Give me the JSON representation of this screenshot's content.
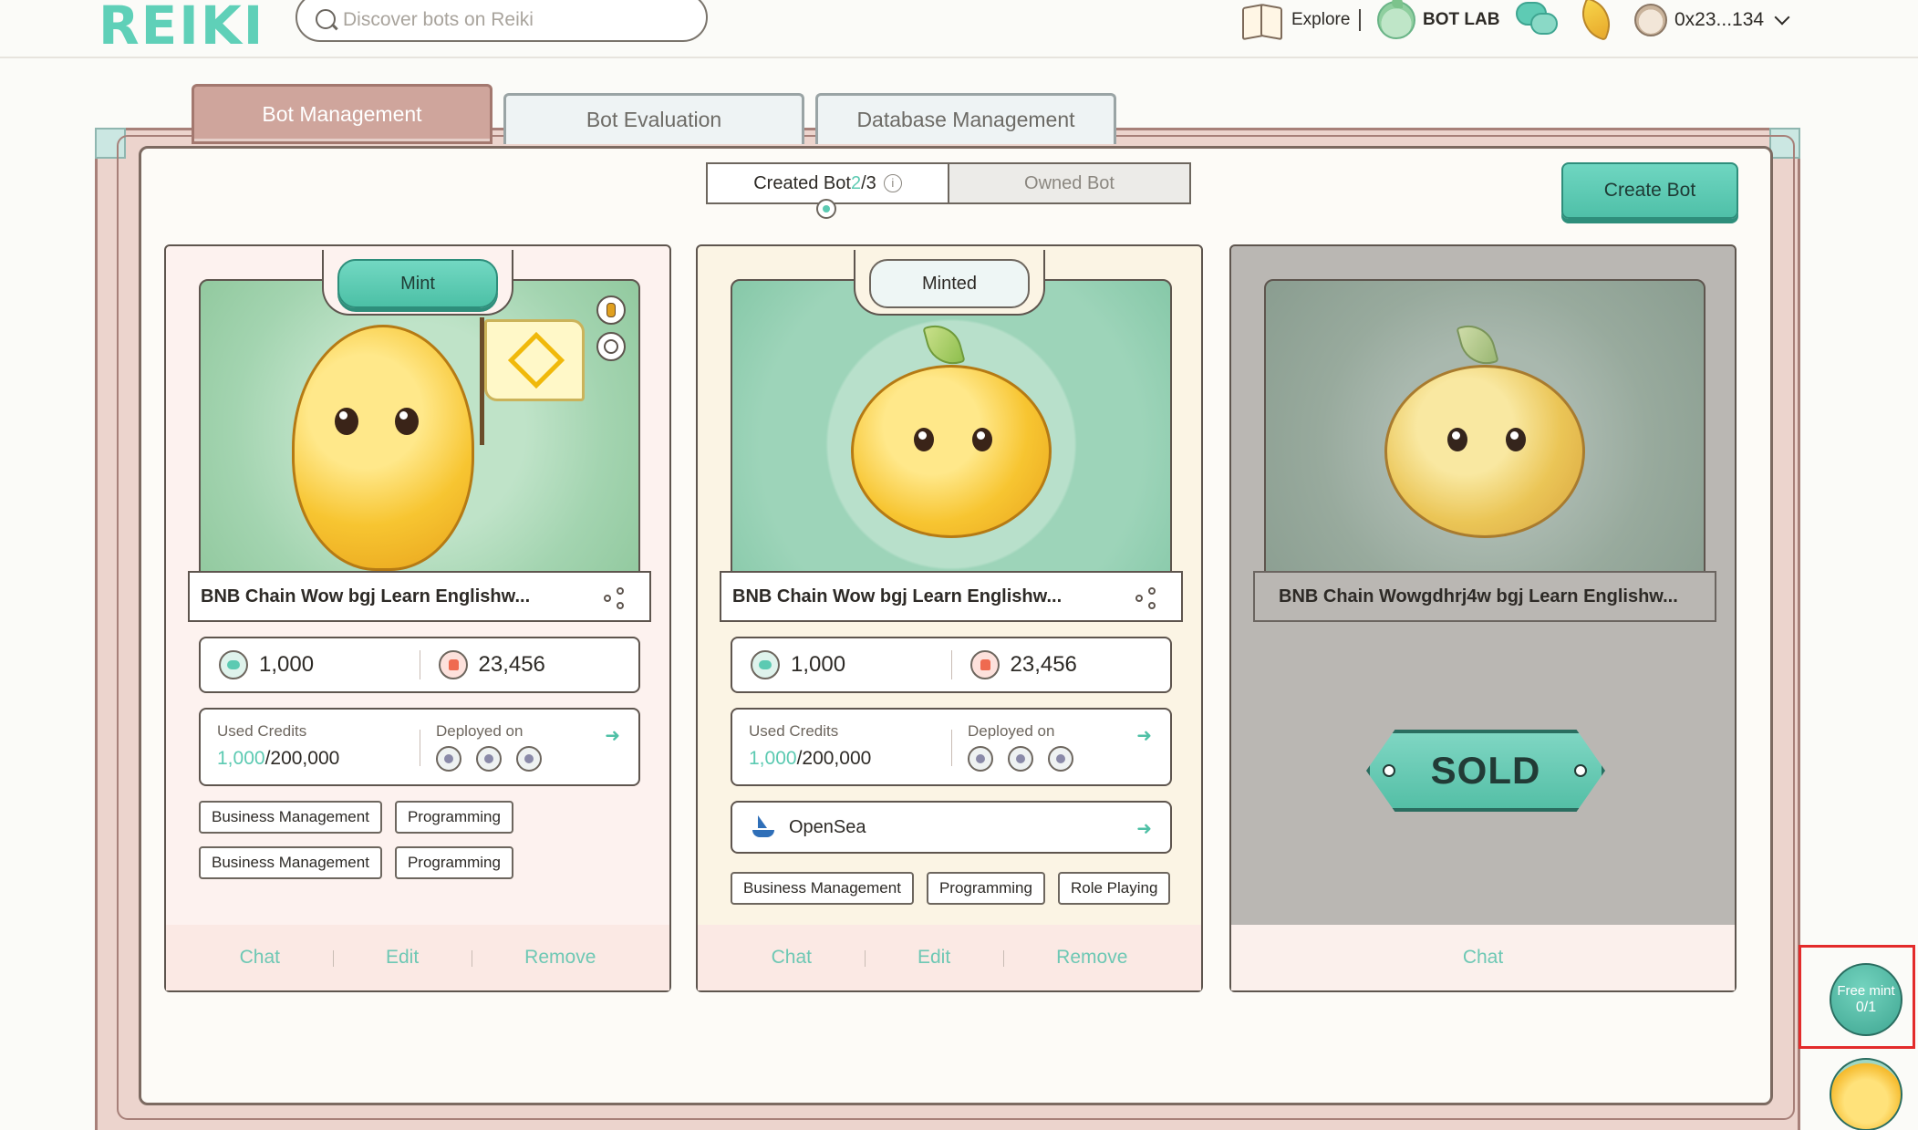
{
  "header": {
    "logo": "REIKI",
    "search_placeholder": "Discover bots on Reiki",
    "explore_label": "Explore",
    "botlab_label": "BOT LAB",
    "wallet_address": "0x23...134"
  },
  "tabs": [
    {
      "label": "Bot Management",
      "active": true
    },
    {
      "label": "Bot Evaluation",
      "active": false
    },
    {
      "label": "Database Management",
      "active": false
    }
  ],
  "toggle": {
    "created_prefix": "Created Bot ",
    "created_count": "2",
    "created_total": "/3",
    "owned_label": "Owned Bot",
    "info_glyph": "i"
  },
  "create_button": "Create Bot",
  "cards": [
    {
      "badge": "Mint",
      "name": "BNB Chain Wow bgj Learn Englishw...",
      "messages": "1,000",
      "likes": "23,456",
      "used_credits_label": "Used Credits",
      "used_credits": "1,000",
      "total_credits": "/200,000",
      "deployed_label": "Deployed on",
      "tags": [
        "Business Management",
        "Programming",
        "Business Management",
        "Programming"
      ],
      "actions": [
        "Chat",
        "Edit",
        "Remove"
      ]
    },
    {
      "badge": "Minted",
      "name": "BNB Chain Wow bgj Learn Englishw...",
      "messages": "1,000",
      "likes": "23,456",
      "used_credits_label": "Used Credits",
      "used_credits": "1,000",
      "total_credits": "/200,000",
      "deployed_label": "Deployed on",
      "market": "OpenSea",
      "tags": [
        "Business Management",
        "Programming",
        "Role Playing"
      ],
      "actions": [
        "Chat",
        "Edit",
        "Remove"
      ]
    },
    {
      "name": "BNB Chain Wowgdhrj4w bgj Learn Englishw...",
      "status": "SOLD",
      "actions": [
        "Chat"
      ]
    }
  ],
  "free_mint": {
    "label": "Free mint",
    "count": "0/1"
  },
  "colors": {
    "accent": "#5ccab2",
    "tab_active": "#cfa59c",
    "highlight_box": "#e32b2b"
  }
}
